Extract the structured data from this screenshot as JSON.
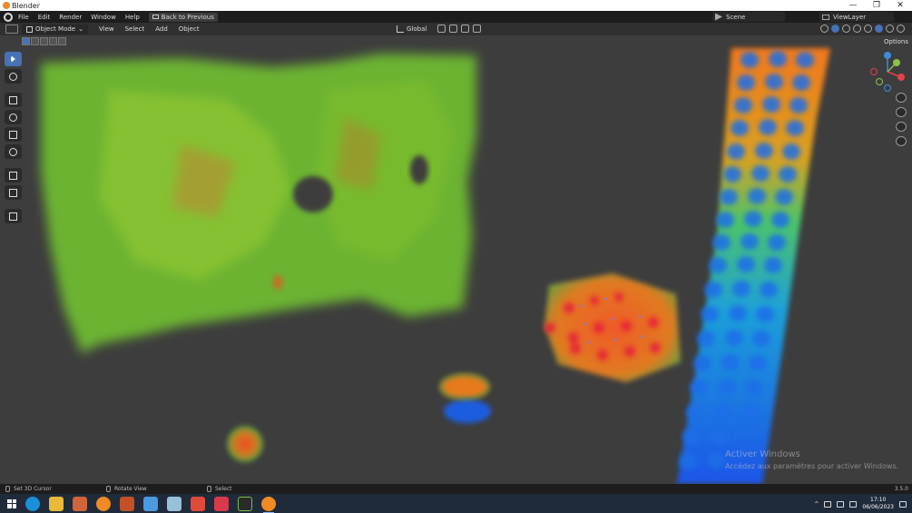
{
  "window": {
    "title": "Blender",
    "controls": [
      "—",
      "❐",
      "✕"
    ]
  },
  "menubar": {
    "items": [
      "File",
      "Edit",
      "Render",
      "Window",
      "Help"
    ],
    "back_button": "Back to Previous",
    "scene": "Scene",
    "view_layer": "ViewLayer"
  },
  "header": {
    "mode": "Object Mode",
    "menus": [
      "View",
      "Select",
      "Add",
      "Object"
    ],
    "transform_orientation": "Global",
    "options": "Options"
  },
  "toolbar": {
    "tools": [
      "select-box",
      "cursor",
      "move",
      "rotate",
      "scale",
      "transform",
      "annotate",
      "measure",
      "add-cube"
    ]
  },
  "gizmo": {
    "axes": [
      "X",
      "Y",
      "Z"
    ],
    "colors": {
      "x": "#e2434b",
      "y": "#8bc34a",
      "z": "#3d8bdf"
    }
  },
  "viewport": {
    "background": "#3d3d3d"
  },
  "watermark": {
    "line1": "Activer Windows",
    "line2": "Accédez aux paramètres pour activer Windows."
  },
  "statusbar": {
    "hint1": "Set 3D Cursor",
    "hint2": "Rotate View",
    "hint3": "Select",
    "version": "3.5.0"
  },
  "taskbar": {
    "time": "17:10",
    "date": "06/06/2023"
  }
}
